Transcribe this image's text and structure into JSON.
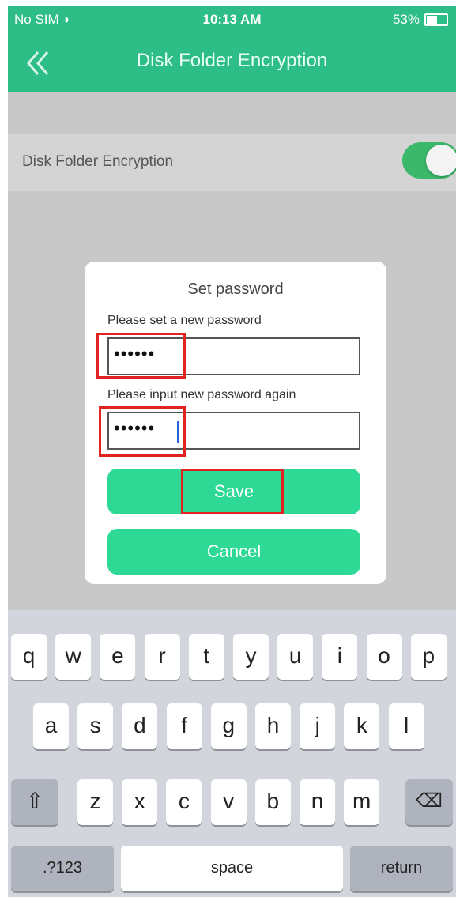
{
  "status_bar": {
    "carrier": "No SIM",
    "wifi_icon": "wifi-icon",
    "time": "10:13 AM",
    "battery_text": "53%",
    "battery_level": 0.53
  },
  "header": {
    "title": "Disk Folder Encryption",
    "back_icon": "double-chevron-left-icon"
  },
  "setting": {
    "label": "Disk Folder Encryption",
    "enabled": true
  },
  "dialog": {
    "title": "Set password",
    "new_password_label": "Please set a new password",
    "new_password_value": "••••••",
    "confirm_password_label": "Please input new password again",
    "confirm_password_value": "••••••",
    "save_label": "Save",
    "cancel_label": "Cancel"
  },
  "keyboard": {
    "row1": [
      "q",
      "w",
      "e",
      "r",
      "t",
      "y",
      "u",
      "i",
      "o",
      "p"
    ],
    "row2": [
      "a",
      "s",
      "d",
      "f",
      "g",
      "h",
      "j",
      "k",
      "l"
    ],
    "row3": [
      "z",
      "x",
      "c",
      "v",
      "b",
      "n",
      "m"
    ],
    "shift_icon": "shift-icon",
    "delete_icon": "backspace-icon",
    "numbers_label": ".?123",
    "space_label": "space",
    "return_label": "return"
  },
  "colors": {
    "accent": "#2dbd86",
    "button": "#2ed895",
    "toggle_on": "#3bb86a",
    "highlight": "#e02222"
  }
}
